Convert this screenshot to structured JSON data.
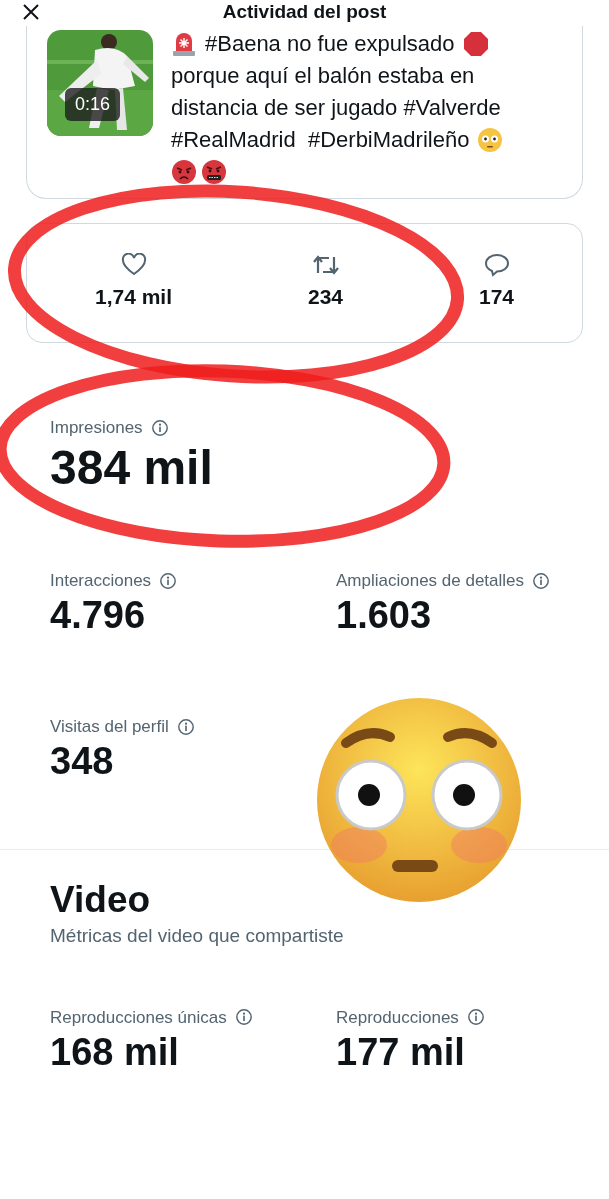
{
  "header": {
    "title": "Actividad del post"
  },
  "post": {
    "thumbnail": {
      "kind": "picture",
      "duration": "0:16"
    },
    "text_lines": [
      "#Baena no fue expulsado",
      "porque aquí el balón estaba en",
      "distancia de ser jugado #Valverde",
      "#RealMadrid  #DerbiMadrileño"
    ]
  },
  "engagement": [
    {
      "kind": "likes",
      "count": "1,74 mil"
    },
    {
      "kind": "reposts",
      "count": "234"
    },
    {
      "kind": "replies",
      "count": "174"
    }
  ],
  "impressions": {
    "label": "Impresiones",
    "value": "384 mil"
  },
  "metrics": [
    {
      "label": "Interacciones",
      "value": "4.796"
    },
    {
      "label": "Ampliaciones de detalles",
      "value": "1.603"
    },
    {
      "label": "Visitas del perfil",
      "value": "348"
    }
  ],
  "video": {
    "title": "Video",
    "subtitle": "Métricas del video que compartiste",
    "metrics": [
      {
        "label": "Reproducciones únicas",
        "value": "168 mil"
      },
      {
        "label": "Reproducciones",
        "value": "177 mil"
      }
    ]
  }
}
